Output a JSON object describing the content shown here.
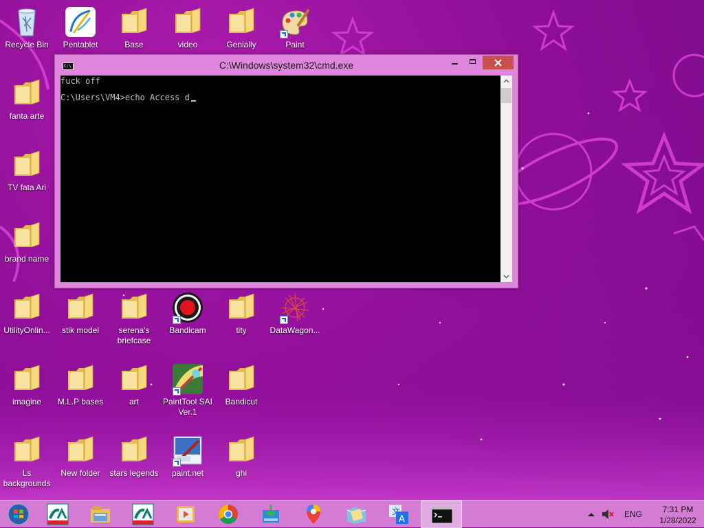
{
  "desktop": {
    "icons": [
      {
        "label": "Recycle Bin",
        "icon": "recycle-bin-icon",
        "shortcut": false
      },
      {
        "label": "Pentablet",
        "icon": "pentablet-icon",
        "shortcut": false
      },
      {
        "label": "Base",
        "icon": "folder-icon",
        "shortcut": false
      },
      {
        "label": "video",
        "icon": "folder-icon",
        "shortcut": false
      },
      {
        "label": "Genially",
        "icon": "folder-icon",
        "shortcut": false
      },
      {
        "label": "Paint",
        "icon": "paint-icon",
        "shortcut": true
      },
      {
        "label": "fanta arte",
        "icon": "folder-icon",
        "shortcut": false
      },
      {
        "label": "TV fata Ari",
        "icon": "folder-icon",
        "shortcut": false
      },
      {
        "label": "brand name",
        "icon": "folder-icon",
        "shortcut": false
      },
      {
        "label": "UtilityOnlin...",
        "icon": "folder-icon",
        "shortcut": false
      },
      {
        "label": "stik model",
        "icon": "folder-icon",
        "shortcut": false
      },
      {
        "label": "serena's briefcase",
        "icon": "folder-icon",
        "shortcut": false
      },
      {
        "label": "Bandicam",
        "icon": "bandicam-icon",
        "shortcut": true
      },
      {
        "label": "tity",
        "icon": "folder-icon",
        "shortcut": false
      },
      {
        "label": "DataWagon...",
        "icon": "datawagon-icon",
        "shortcut": true
      },
      {
        "label": "imagine",
        "icon": "folder-icon",
        "shortcut": false
      },
      {
        "label": "M.L.P bases",
        "icon": "folder-icon",
        "shortcut": false
      },
      {
        "label": "art",
        "icon": "folder-icon",
        "shortcut": false
      },
      {
        "label": "PaintTool SAI Ver.1",
        "icon": "painttool-sai-icon",
        "shortcut": true
      },
      {
        "label": "Bandicut",
        "icon": "folder-icon",
        "shortcut": false
      },
      {
        "label": "Ls backgrounds",
        "icon": "folder-icon",
        "shortcut": false
      },
      {
        "label": "New folder",
        "icon": "folder-icon",
        "shortcut": false
      },
      {
        "label": "stars legends",
        "icon": "folder-icon",
        "shortcut": false
      },
      {
        "label": "paint.net",
        "icon": "paint-net-icon",
        "shortcut": true
      },
      {
        "label": "ghi",
        "icon": "folder-icon",
        "shortcut": false
      }
    ]
  },
  "cmd": {
    "title": "C:\\Windows\\system32\\cmd.exe",
    "line1": "fuck off",
    "line2": "C:\\Users\\VM4>echo Access d"
  },
  "taskbar": {
    "items": [
      "start-button",
      "credit-agricole-app",
      "file-explorer",
      "credit-agricole-app-2",
      "video-player",
      "chrome",
      "app-installer",
      "google-maps",
      "folder-app",
      "translator",
      "cmd"
    ],
    "lang": "ENG",
    "time": "7:31 PM",
    "date": "1/28/2022"
  },
  "colors": {
    "accent": "#d47bd4",
    "close": "#c7504f"
  }
}
